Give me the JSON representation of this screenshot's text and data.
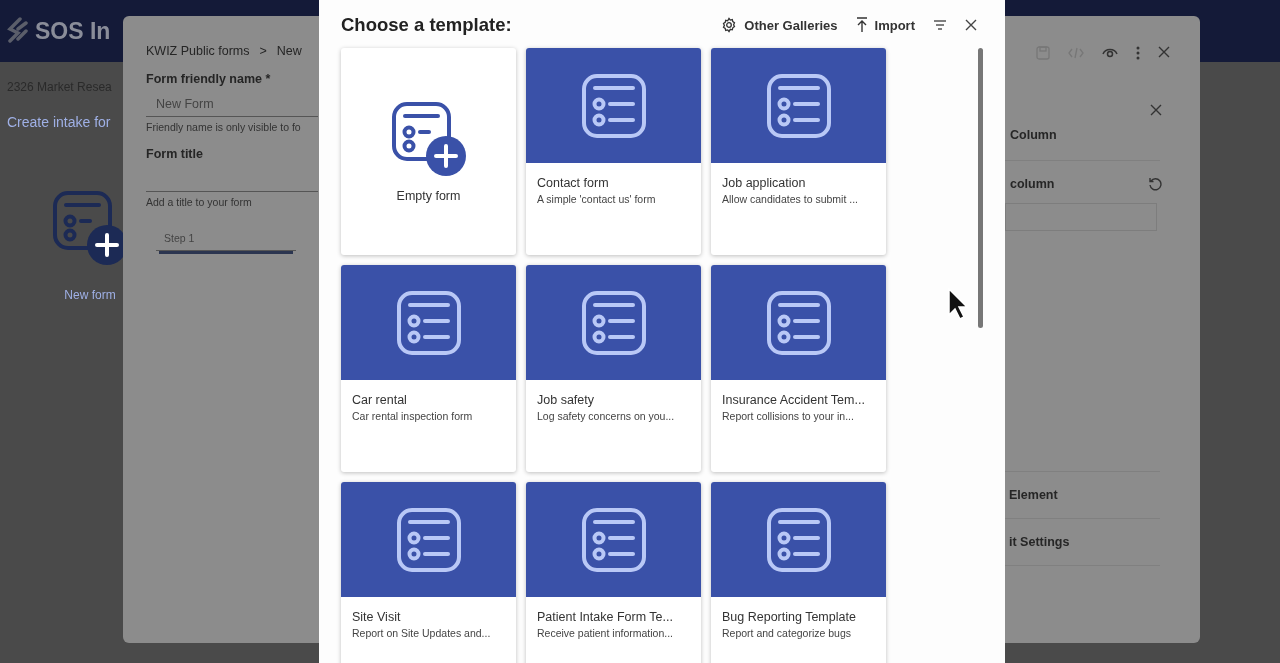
{
  "app_header": {
    "title": "SOS In"
  },
  "page": {
    "subtitle": "2326 Market Resea",
    "heading": "Create intake for",
    "new_form_label": "New form"
  },
  "editor": {
    "breadcrumb": [
      "KWIZ Public forms",
      "New"
    ],
    "breadcrumb_separator": ">",
    "fields": [
      {
        "label": "Form friendly name *",
        "value": "New Form",
        "hint": "Friendly name is only visible to fo"
      },
      {
        "label": "Form title",
        "hint": "Add a title to your form"
      }
    ],
    "steps": [
      {
        "label": "Step 1",
        "selected": true
      }
    ],
    "side_panel": {
      "section_title": "Column",
      "field_label": "column",
      "bottom_items": [
        "Element",
        "it Settings"
      ]
    }
  },
  "dialog": {
    "title": "Choose a template:",
    "actions": [
      {
        "kind": "galleries",
        "label": "Other Galleries"
      },
      {
        "kind": "import",
        "label": "Import"
      }
    ],
    "templates": [
      {
        "kind": "empty",
        "title": "Empty form"
      },
      {
        "kind": "template",
        "title": "Contact form",
        "description": "A simple 'contact us' form"
      },
      {
        "kind": "template",
        "title": "Job application",
        "description": "Allow candidates to submit ..."
      },
      {
        "kind": "template",
        "title": "Car rental",
        "description": "Car rental inspection form"
      },
      {
        "kind": "template",
        "title": "Job safety",
        "description": "Log safety concerns on you..."
      },
      {
        "kind": "template",
        "title": "Insurance Accident Tem...",
        "description": "Report collisions to your in..."
      },
      {
        "kind": "template",
        "title": "Site Visit",
        "description": "Report on Site Updates and..."
      },
      {
        "kind": "template",
        "title": "Patient Intake Form Te...",
        "description": "Receive patient information..."
      },
      {
        "kind": "template",
        "title": "Bug Reporting Template",
        "description": "Report and categorize bugs"
      }
    ]
  }
}
